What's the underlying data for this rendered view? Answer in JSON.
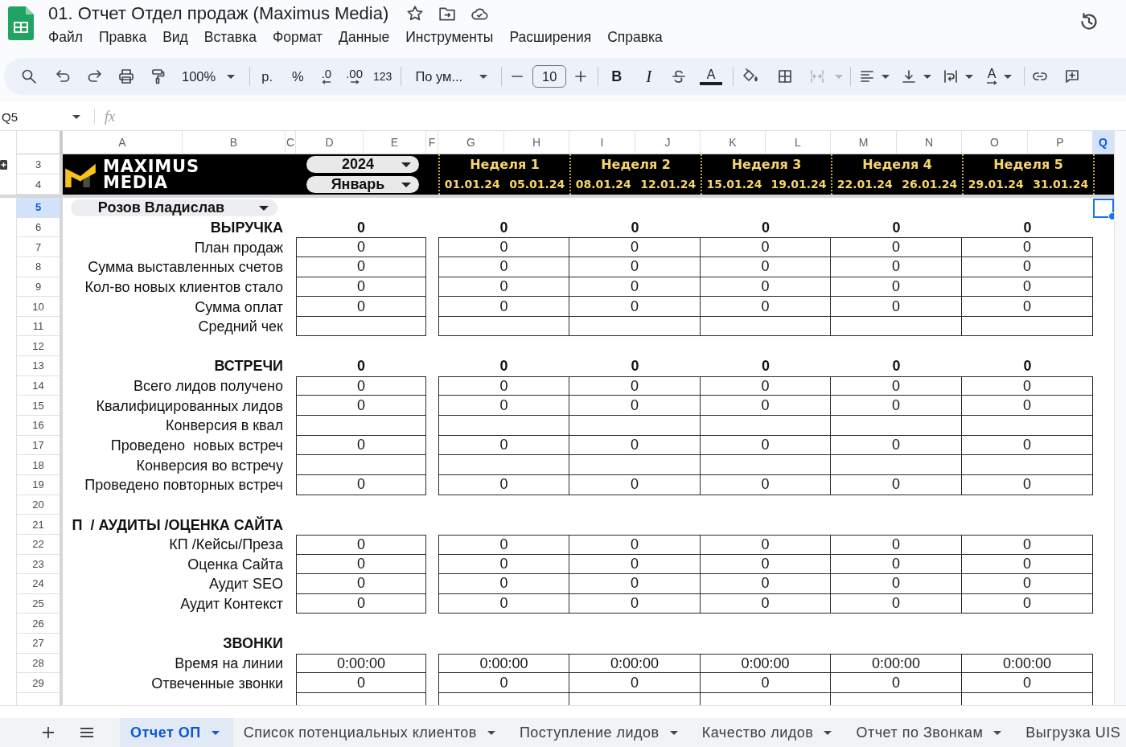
{
  "document": {
    "title": "01. Отчет Отдел продаж (Maximus Media)",
    "menu": [
      "Файл",
      "Правка",
      "Вид",
      "Вставка",
      "Формат",
      "Данные",
      "Инструменты",
      "Расширения",
      "Справка"
    ]
  },
  "toolbar": {
    "zoom": "100%",
    "currency": "р.",
    "percent": "%",
    "decimals_less": ".0",
    "decimals_more": ".00",
    "number_format": "123",
    "font": "По ум...",
    "font_size": "10",
    "bold": "B",
    "italic": "I",
    "text_color": "A",
    "text_rotation": "A",
    "merge_disabled": true
  },
  "formula_bar": {
    "cell": "Q5",
    "function_label": "fx"
  },
  "sheet": {
    "columns": [
      {
        "label": "A",
        "selected": false
      },
      {
        "label": "B",
        "selected": false
      },
      {
        "label": "C",
        "selected": false
      },
      {
        "label": "D",
        "selected": false
      },
      {
        "label": "E",
        "selected": false
      },
      {
        "label": "F",
        "selected": false
      },
      {
        "label": "G",
        "selected": false
      },
      {
        "label": "H",
        "selected": false
      },
      {
        "label": "I",
        "selected": false
      },
      {
        "label": "J",
        "selected": false
      },
      {
        "label": "K",
        "selected": false
      },
      {
        "label": "L",
        "selected": false
      },
      {
        "label": "M",
        "selected": false
      },
      {
        "label": "N",
        "selected": false
      },
      {
        "label": "O",
        "selected": false
      },
      {
        "label": "P",
        "selected": false
      },
      {
        "label": "Q",
        "selected": true
      }
    ],
    "banner": {
      "rows": [
        {
          "number": "3",
          "selected": false
        },
        {
          "number": "4",
          "selected": false
        }
      ],
      "logo_lines": [
        "MAXIMUS",
        "MEDIA"
      ],
      "year": "2024",
      "month": "Январь",
      "weeks": [
        {
          "label": "Неделя 1",
          "start": "01.01.24",
          "end": "05.01.24"
        },
        {
          "label": "Неделя 2",
          "start": "08.01.24",
          "end": "12.01.24"
        },
        {
          "label": "Неделя 3",
          "start": "15.01.24",
          "end": "19.01.24"
        },
        {
          "label": "Неделя 4",
          "start": "22.01.24",
          "end": "26.01.24"
        },
        {
          "label": "Неделя 5",
          "start": "29.01.24",
          "end": "31.01.24"
        }
      ]
    },
    "filter_row": {
      "number": "5",
      "selected": true,
      "manager": "Розов Владислав"
    },
    "rows": [
      {
        "number": "6",
        "selected": false,
        "kind": "section",
        "label": "ВЫРУЧКА",
        "values": [
          "0",
          "0",
          "0",
          "0",
          "0",
          "0"
        ]
      },
      {
        "number": "7",
        "selected": false,
        "kind": "metric",
        "label": "План продаж",
        "values": [
          "0",
          "0",
          "0",
          "0",
          "0",
          "0"
        ]
      },
      {
        "number": "8",
        "selected": false,
        "kind": "metric",
        "label": "Сумма выставленных счетов",
        "values": [
          "0",
          "0",
          "0",
          "0",
          "0",
          "0"
        ]
      },
      {
        "number": "9",
        "selected": false,
        "kind": "metric",
        "label": "Кол-во новых клиентов стало",
        "values": [
          "0",
          "0",
          "0",
          "0",
          "0",
          "0"
        ]
      },
      {
        "number": "10",
        "selected": false,
        "kind": "metric",
        "label": "Сумма оплат",
        "values": [
          "0",
          "0",
          "0",
          "0",
          "0",
          "0"
        ]
      },
      {
        "number": "11",
        "selected": false,
        "kind": "metric",
        "label": "Средний чек"
      },
      {
        "number": "12",
        "selected": false,
        "kind": "blank"
      },
      {
        "number": "13",
        "selected": false,
        "kind": "section",
        "label": "ВСТРЕЧИ",
        "values": [
          "0",
          "0",
          "0",
          "0",
          "0",
          "0"
        ]
      },
      {
        "number": "14",
        "selected": false,
        "kind": "metric",
        "label": "Всего лидов получено",
        "values": [
          "0",
          "0",
          "0",
          "0",
          "0",
          "0"
        ]
      },
      {
        "number": "15",
        "selected": false,
        "kind": "metric",
        "label": "Квалифицированных лидов",
        "values": [
          "0",
          "0",
          "0",
          "0",
          "0",
          "0"
        ]
      },
      {
        "number": "16",
        "selected": false,
        "kind": "metric",
        "label": "Конверсия в квал"
      },
      {
        "number": "17",
        "selected": false,
        "kind": "metric",
        "label": "Проведено  новых встреч",
        "values": [
          "0",
          "0",
          "0",
          "0",
          "0",
          "0"
        ]
      },
      {
        "number": "18",
        "selected": false,
        "kind": "metric",
        "label": "Конверсия во встречу"
      },
      {
        "number": "19",
        "selected": false,
        "kind": "metric",
        "label": "Проведено повторных встреч",
        "values": [
          "0",
          "0",
          "0",
          "0",
          "0",
          "0"
        ]
      },
      {
        "number": "20",
        "selected": false,
        "kind": "blank"
      },
      {
        "number": "21",
        "selected": false,
        "kind": "section",
        "label": "П  / АУДИТЫ /ОЦЕНКА САЙТА"
      },
      {
        "number": "22",
        "selected": false,
        "kind": "metric",
        "label": "КП /Кейсы/Преза",
        "values": [
          "0",
          "0",
          "0",
          "0",
          "0",
          "0"
        ]
      },
      {
        "number": "23",
        "selected": false,
        "kind": "metric",
        "label": "Оценка Сайта",
        "values": [
          "0",
          "0",
          "0",
          "0",
          "0",
          "0"
        ]
      },
      {
        "number": "24",
        "selected": false,
        "kind": "metric",
        "label": "Аудит SEO",
        "values": [
          "0",
          "0",
          "0",
          "0",
          "0",
          "0"
        ]
      },
      {
        "number": "25",
        "selected": false,
        "kind": "metric",
        "label": "Аудит Контекст",
        "values": [
          "0",
          "0",
          "0",
          "0",
          "0",
          "0"
        ]
      },
      {
        "number": "26",
        "selected": false,
        "kind": "blank"
      },
      {
        "number": "27",
        "selected": false,
        "kind": "section",
        "label": "ЗВОНКИ"
      },
      {
        "number": "28",
        "selected": false,
        "kind": "metric",
        "label": "Время на линии",
        "values": [
          "0:00:00",
          "0:00:00",
          "0:00:00",
          "0:00:00",
          "0:00:00",
          "0:00:00"
        ]
      },
      {
        "number": "29",
        "selected": false,
        "kind": "metric",
        "label": "Отвеченные звонки",
        "values": [
          "0",
          "0",
          "0",
          "0",
          "0",
          "0"
        ]
      },
      {
        "kind": "metric"
      }
    ]
  },
  "sheet_tabs": [
    {
      "label": "Отчет ОП",
      "selected": true,
      "caret": true
    },
    {
      "label": "Список потенциальных клиентов",
      "selected": false,
      "caret": true
    },
    {
      "label": "Поступление лидов",
      "selected": false,
      "caret": true
    },
    {
      "label": "Качество лидов",
      "selected": false,
      "caret": true
    },
    {
      "label": "Отчет по Звонкам",
      "selected": false,
      "caret": true
    },
    {
      "label": "Выгрузка UIS",
      "selected": false,
      "caret": false
    }
  ]
}
